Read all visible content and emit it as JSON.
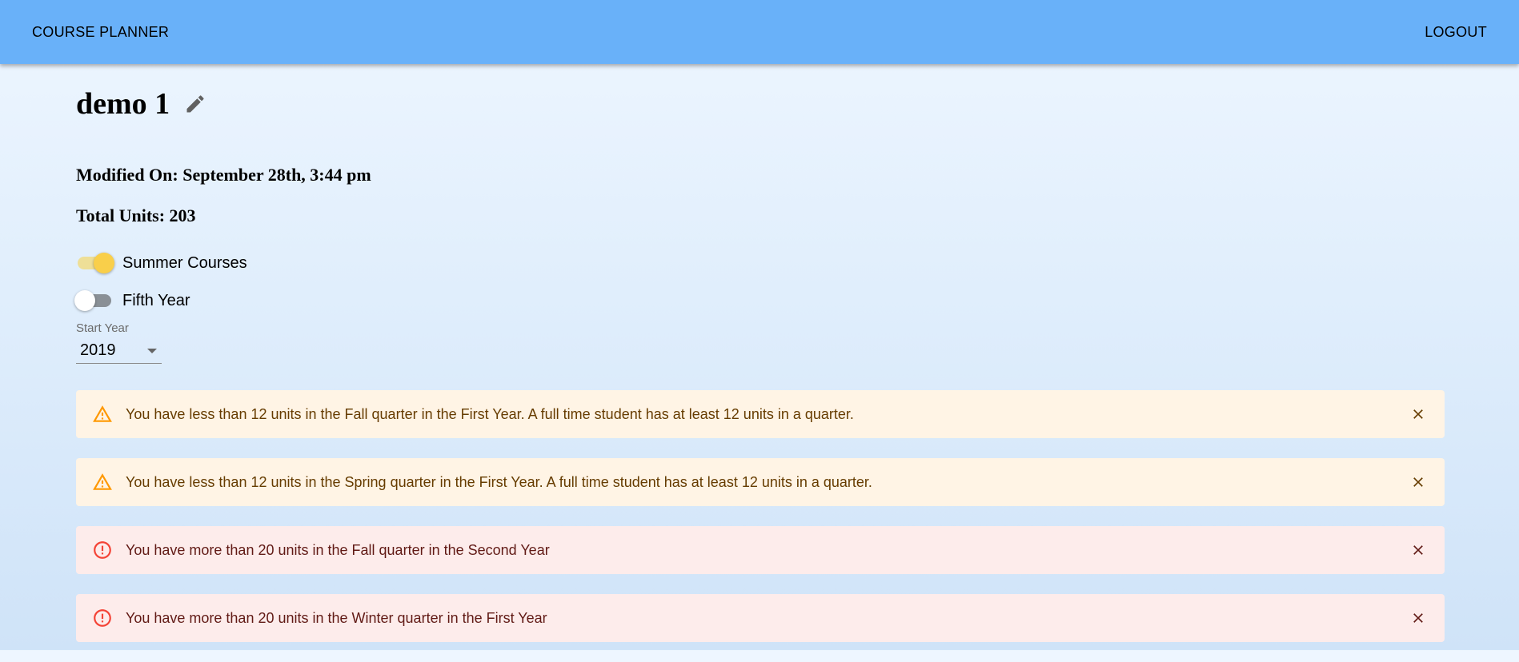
{
  "header": {
    "app_title": "COURSE PLANNER",
    "logout_label": "LOGOUT"
  },
  "plan": {
    "name": "demo 1",
    "modified_on": "Modified On: September 28th, 3:44 pm",
    "total_units": "Total Units: 203"
  },
  "toggles": {
    "summer": {
      "label": "Summer Courses",
      "checked": true
    },
    "fifth_year": {
      "label": "Fifth Year",
      "checked": false
    }
  },
  "start_year": {
    "label": "Start Year",
    "value": "2019"
  },
  "alerts": [
    {
      "severity": "warning",
      "icon": "warning-icon",
      "message": "You have less than 12 units in the Fall quarter in the First Year. A full time student has at least 12 units in a quarter."
    },
    {
      "severity": "warning",
      "icon": "warning-icon",
      "message": "You have less than 12 units in the Spring quarter in the First Year. A full time student has at least 12 units in a quarter."
    },
    {
      "severity": "error",
      "icon": "error-icon",
      "message": "You have more than 20 units in the Fall quarter in the Second Year"
    },
    {
      "severity": "error",
      "icon": "error-icon",
      "message": "You have more than 20 units in the Winter quarter in the First Year"
    }
  ],
  "colors": {
    "appbar": "#69b1f9",
    "switch_on": "#f9cf4a",
    "warning_bg": "#fff4e5",
    "warning_icon": "#ff9800",
    "error_bg": "#fdeceb",
    "error_icon": "#f44336"
  }
}
